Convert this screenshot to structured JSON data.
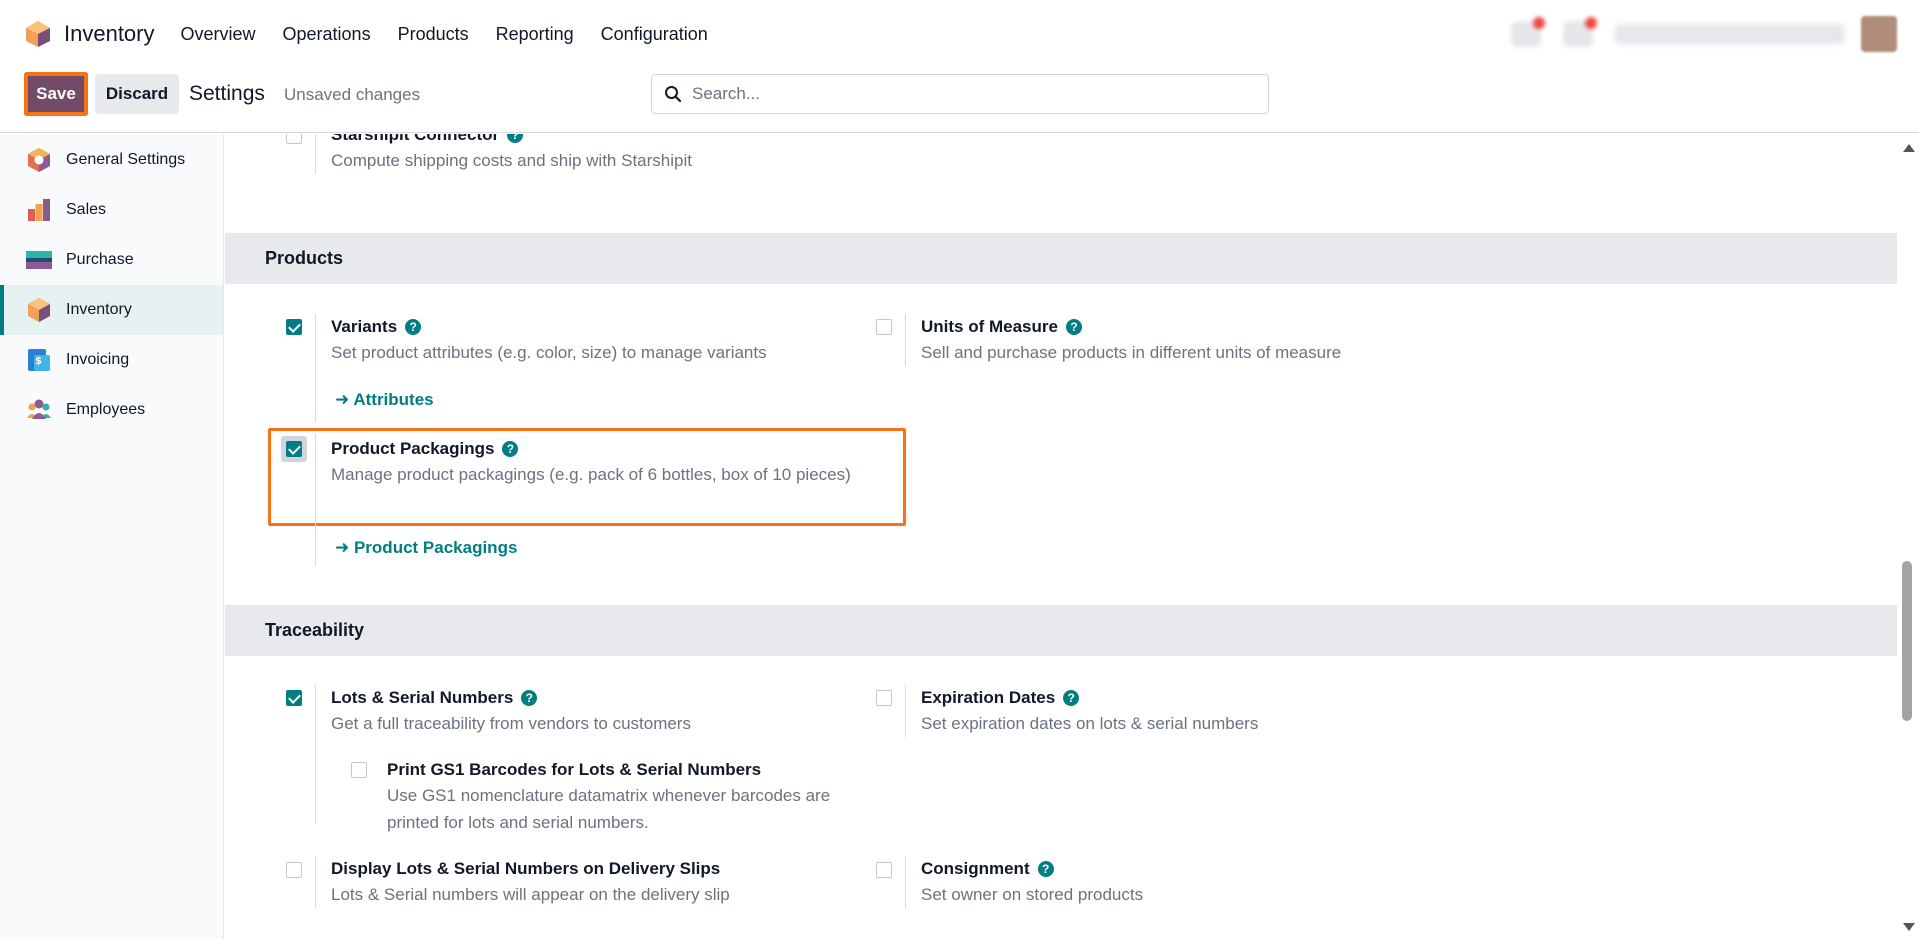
{
  "app": {
    "name": "Inventory",
    "menu": [
      "Overview",
      "Operations",
      "Products",
      "Reporting",
      "Configuration"
    ],
    "accent": "#714b67",
    "teal": "#017e84",
    "highlight": "#f97316"
  },
  "control": {
    "save_label": "Save",
    "discard_label": "Discard",
    "title": "Settings",
    "status": "Unsaved changes",
    "search_placeholder": "Search..."
  },
  "sidebar": {
    "items": [
      {
        "label": "General Settings",
        "icon": "odoo-settings-icon"
      },
      {
        "label": "Sales",
        "icon": "sales-chart-icon"
      },
      {
        "label": "Purchase",
        "icon": "purchase-icon"
      },
      {
        "label": "Inventory",
        "icon": "inventory-box-icon",
        "active": true
      },
      {
        "label": "Invoicing",
        "icon": "invoicing-icon"
      },
      {
        "label": "Employees",
        "icon": "employees-icon"
      }
    ]
  },
  "content": {
    "starshipit": {
      "title": "Starshipit Connector",
      "desc": "Compute shipping costs and ship with Starshipit"
    },
    "products_header": "Products",
    "variants": {
      "title": "Variants",
      "desc": "Set product attributes (e.g. color, size) to manage variants",
      "link": "Attributes",
      "checked": true
    },
    "uom": {
      "title": "Units of Measure",
      "desc": "Sell and purchase products in different units of measure",
      "checked": false
    },
    "packagings": {
      "title": "Product Packagings",
      "desc": "Manage product packagings (e.g. pack of 6 bottles, box of 10 pieces)",
      "link": "Product Packagings",
      "checked": true
    },
    "traceability_header": "Traceability",
    "lots": {
      "title": "Lots & Serial Numbers",
      "desc": "Get a full traceability from vendors to customers",
      "checked": true
    },
    "expiration": {
      "title": "Expiration Dates",
      "desc": "Set expiration dates on lots & serial numbers",
      "checked": false
    },
    "gs1": {
      "title": "Print GS1 Barcodes for Lots & Serial Numbers",
      "desc": "Use GS1 nomenclature datamatrix whenever barcodes are printed for lots and serial numbers.",
      "checked": false
    },
    "display_lots": {
      "title": "Display Lots & Serial Numbers on Delivery Slips",
      "desc": "Lots & Serial numbers will appear on the delivery slip",
      "checked": false
    },
    "consignment": {
      "title": "Consignment",
      "desc": "Set owner on stored products",
      "checked": false
    }
  }
}
